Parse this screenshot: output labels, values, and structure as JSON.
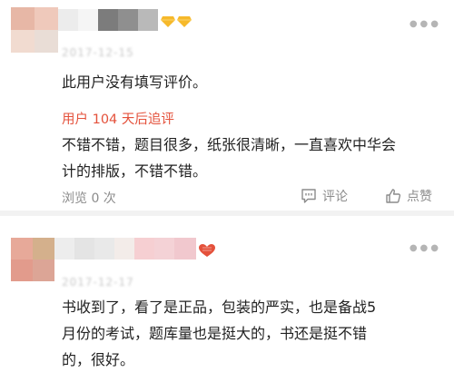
{
  "reviews": [
    {
      "date": "2017-12-15",
      "badge_icon": "diamond-icon",
      "default_text": "此用户没有填写评价。",
      "followup_label": "用户 104 天后追评",
      "followup_lines": [
        "不错不错，题目很多，纸张很清晰，一直喜欢中华会",
        "计的排版，不错不错。"
      ],
      "views": "浏览 0 次",
      "comment_label": "评论",
      "like_label": "点赞"
    },
    {
      "date": "2017-12-17",
      "badge_icon": "heart-icon",
      "text_lines": [
        "书收到了，看了是正品，包装的严实，也是备战5",
        "月份的考试，题库量也是挺大的，书还是挺不错",
        "的，很好。"
      ]
    }
  ],
  "colors": {
    "accent": "#e4513b",
    "muted": "#8c8c8c",
    "text": "#222222",
    "divider": "#f2f2f2"
  }
}
